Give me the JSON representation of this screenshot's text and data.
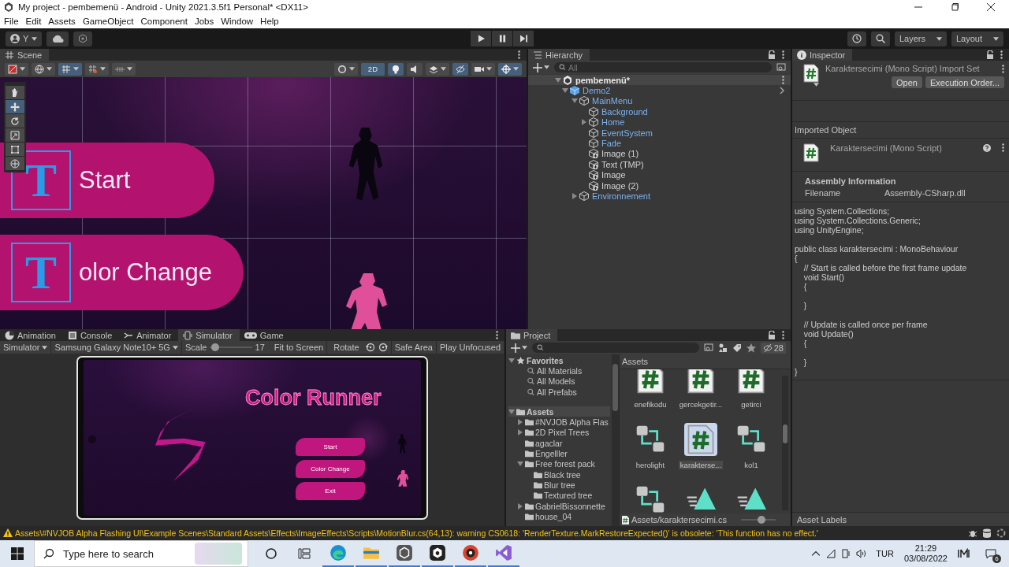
{
  "window": {
    "title": "My project - pembemenü - Android - Unity 2021.3.5f1 Personal* <DX11>"
  },
  "menu": [
    "File",
    "Edit",
    "Assets",
    "GameObject",
    "Component",
    "Jobs",
    "Window",
    "Help"
  ],
  "toolbar": {
    "account": "Y",
    "layers": "Layers",
    "layout": "Layout"
  },
  "scene": {
    "tab": "Scene",
    "toggle_2d": {
      "label": "2D",
      "on": true
    },
    "toggles": [
      {
        "kind": "lighting",
        "on": true
      },
      {
        "kind": "audio",
        "on": false
      },
      {
        "kind": "effects",
        "on": false
      },
      {
        "kind": "visibility",
        "on": true
      }
    ],
    "tools": [
      {
        "kind": "hand",
        "selected": false
      },
      {
        "kind": "move",
        "selected": true
      },
      {
        "kind": "rotate",
        "selected": false
      },
      {
        "kind": "scale",
        "selected": false
      },
      {
        "kind": "rect",
        "selected": false
      },
      {
        "kind": "transform",
        "selected": false
      }
    ],
    "banners": [
      {
        "label": "Start",
        "icon": "T"
      },
      {
        "label": "olor Change",
        "icon": "T"
      }
    ]
  },
  "hierarchy": {
    "tab": "Hierarchy",
    "search_placeholder": "All",
    "tree": [
      {
        "name": "pembemenü*",
        "kind": "scene",
        "expanded": true,
        "children": [
          {
            "name": "Demo2",
            "kind": "prefab_root",
            "expanded": true,
            "children": [
              {
                "name": "MainMenu",
                "kind": "prefab",
                "expanded": true,
                "children": [
                  {
                    "name": "Background",
                    "kind": "prefab"
                  },
                  {
                    "name": "Home",
                    "kind": "prefab",
                    "expanded": false
                  },
                  {
                    "name": "EventSystem",
                    "kind": "prefab"
                  },
                  {
                    "name": "Fade",
                    "kind": "prefab"
                  },
                  {
                    "name": "Image (1)",
                    "kind": "added"
                  },
                  {
                    "name": "Text (TMP)",
                    "kind": "added"
                  },
                  {
                    "name": "Image",
                    "kind": "added"
                  },
                  {
                    "name": "Image (2)",
                    "kind": "added"
                  }
                ]
              },
              {
                "name": "Environnement",
                "kind": "prefab",
                "expanded": false
              }
            ]
          }
        ]
      }
    ]
  },
  "inspector": {
    "tab": "Inspector",
    "header_title": "Karaktersecimi (Mono Script) Import Set",
    "buttons": [
      "Open",
      "Execution Order..."
    ],
    "section": "Imported Object",
    "object_title": "Karaktersecimi (Mono Script)",
    "assembly_heading": "Assembly Information",
    "filename_label": "Filename",
    "filename_value": "Assembly-CSharp.dll",
    "code": "using System.Collections;\nusing System.Collections.Generic;\nusing UnityEngine;\n\npublic class karaktersecimi : MonoBehaviour\n{\n    // Start is called before the first frame update\n    void Start()\n    {\n\n    }\n\n    // Update is called once per frame\n    void Update()\n    {\n\n    }\n}",
    "footer": "Asset Labels"
  },
  "bottom_tabs": [
    {
      "label": "Animation",
      "kind": "animation",
      "selected": false
    },
    {
      "label": "Console",
      "kind": "console",
      "selected": false
    },
    {
      "label": "Animator",
      "kind": "animator",
      "selected": false
    },
    {
      "label": "Simulator",
      "kind": "simulator",
      "selected": true
    },
    {
      "label": "Game",
      "kind": "game",
      "selected": false
    }
  ],
  "simulator": {
    "mode": "Simulator",
    "device": "Samsung Galaxy Note10+ 5G",
    "scale_label": "Scale",
    "scale": {
      "level": 0.12
    },
    "scale_value": "17",
    "fit": "Fit to Screen",
    "rotate": "Rotate",
    "safe_area": "Safe Area",
    "play_unfocused": "Play Unfocused",
    "game": {
      "title": "Color Runner",
      "buttons": [
        "Start",
        "Color Change",
        "Exit"
      ]
    }
  },
  "project": {
    "tab": "Project",
    "hidden_count": "28",
    "favorites": {
      "label": "Favorites",
      "expanded": true,
      "items": [
        "All Materials",
        "All Models",
        "All Prefabs"
      ]
    },
    "assets_tree": {
      "label": "Assets",
      "expanded": true,
      "children": [
        {
          "name": "#NVJOB Alpha Flas",
          "expanded": false
        },
        {
          "name": "2D Pixel Trees",
          "expanded": false
        },
        {
          "name": "agaclar"
        },
        {
          "name": "Engelller"
        },
        {
          "name": "Free forest pack",
          "expanded": true,
          "children": [
            {
              "name": "Black tree"
            },
            {
              "name": "Blur tree"
            },
            {
              "name": "Textured tree"
            }
          ]
        },
        {
          "name": "GabrielBissonnette",
          "expanded": false
        },
        {
          "name": "house_04"
        }
      ]
    },
    "breadcrumb": "Assets",
    "assets": [
      {
        "name": "enefikodu",
        "kind": "script",
        "selected": false
      },
      {
        "name": "gercekgetir...",
        "kind": "script",
        "selected": false
      },
      {
        "name": "getirci",
        "kind": "script",
        "selected": false
      },
      {
        "name": "herolight",
        "kind": "animator",
        "selected": false
      },
      {
        "name": "karakterse...",
        "kind": "script",
        "selected": true
      },
      {
        "name": "kol1",
        "kind": "animator",
        "selected": false
      },
      {
        "kind": "animator",
        "selected": false
      },
      {
        "kind": "animation",
        "selected": false
      },
      {
        "kind": "animation",
        "selected": false
      }
    ],
    "path": "Assets/karaktersecimi.cs",
    "zoom": {
      "level": 0.6
    }
  },
  "status": {
    "kind": "warning",
    "message": "Assets\\#NVJOB Alpha Flashing UI\\Example Scenes\\Standard Assets\\Effects\\ImageEffects\\Scripts\\MotionBlur.cs(64,13): warning CS0618: 'RenderTexture.MarkRestoreExpected()' is obsolete: 'This function has no effect.'"
  },
  "taskbar": {
    "search_placeholder": "Type here to search",
    "language": "TUR",
    "time": "21:29",
    "date": "03/08/2022",
    "notifications": "6"
  }
}
